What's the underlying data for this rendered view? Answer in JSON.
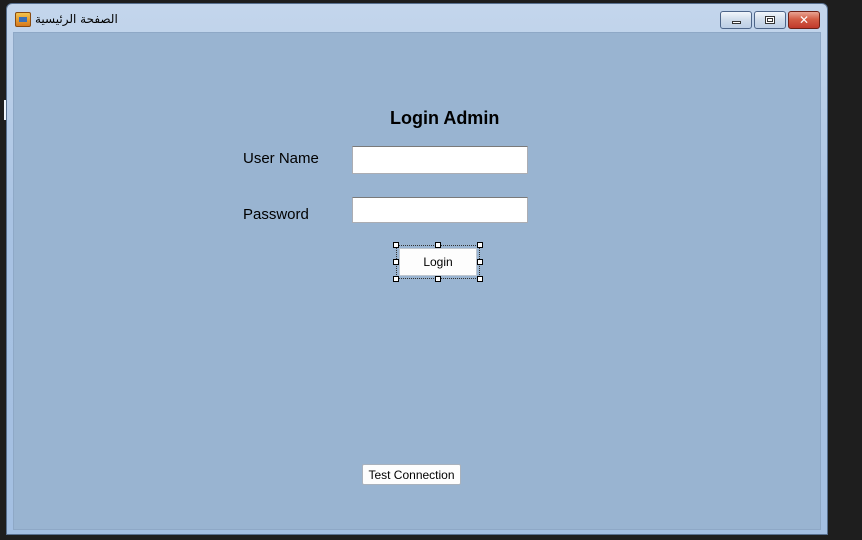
{
  "window": {
    "title": "الصفحة الرئيسية",
    "icon": "app-icon"
  },
  "caption_buttons": {
    "minimize_icon": "minimize-icon",
    "maximize_icon": "maximize-icon",
    "close_icon": "close-icon",
    "close_glyph": "✕"
  },
  "form": {
    "heading": "Login Admin",
    "username_label": "User Name",
    "username_value": "",
    "password_label": "Password",
    "password_value": "",
    "login_button": "Login",
    "test_button": "Test Connection"
  },
  "colors": {
    "client_background": "#99b4d1",
    "close_button": "#c0392b"
  }
}
